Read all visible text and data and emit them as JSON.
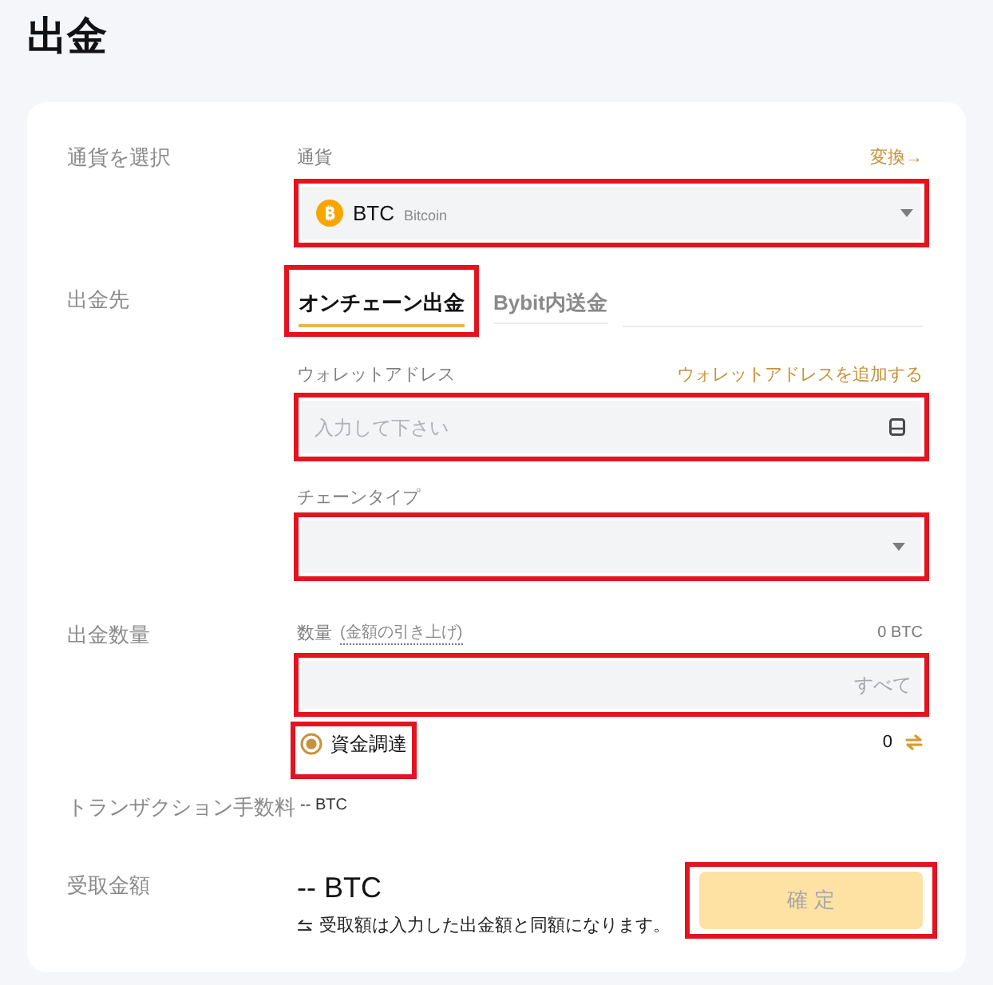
{
  "page": {
    "title": "出金"
  },
  "currency": {
    "section_label": "通貨を選択",
    "label": "通貨",
    "link": "変換→",
    "code": "BTC",
    "name": "Bitcoin",
    "highlighted": true
  },
  "destination": {
    "section_label": "出金先",
    "tabs": [
      {
        "label": "オンチェーン出金",
        "selected": true,
        "highlighted": true
      },
      {
        "label": "Bybit内送金",
        "selected": false,
        "highlighted": false
      }
    ]
  },
  "wallet_address": {
    "label": "ウォレットアドレス",
    "link": "ウォレットアドレスを追加する",
    "placeholder": "入力して下さい",
    "highlighted": true
  },
  "chain_type": {
    "label": "チェーンタイプ",
    "highlighted": true
  },
  "amount": {
    "section_label": "出金数量",
    "label": "数量",
    "label_note": "(金額の引き上げ)",
    "available": "0 BTC",
    "all_button": "すべて",
    "highlighted": true
  },
  "funding": {
    "label": "資金調達",
    "selected": true,
    "highlighted": true,
    "balance": "0"
  },
  "fee": {
    "label": "トランザクション手数料",
    "value": "-- BTC"
  },
  "receive": {
    "label": "受取金額",
    "amount": "-- BTC",
    "note": "受取額は入力した出金額と同額になります。"
  },
  "confirm": {
    "label": "確定",
    "disabled": true,
    "highlighted": true
  }
}
